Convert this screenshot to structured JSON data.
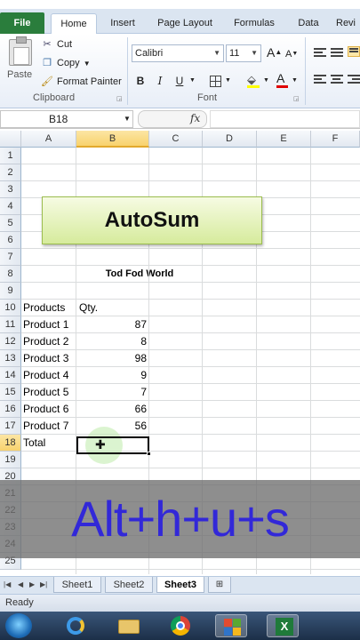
{
  "ribbon": {
    "tabs": {
      "file": "File",
      "home": "Home",
      "insert": "Insert",
      "page_layout": "Page Layout",
      "formulas": "Formulas",
      "data": "Data",
      "review": "Revi"
    },
    "clipboard": {
      "paste": "Paste",
      "cut": "Cut",
      "copy": "Copy",
      "format_painter": "Format Painter",
      "group_label": "Clipboard"
    },
    "font": {
      "font_name": "Calibri",
      "font_size": "11",
      "grow_label": "A",
      "shrink_label": "A",
      "bold": "B",
      "italic": "I",
      "underline": "U",
      "group_label": "Font"
    }
  },
  "formula_bar": {
    "name_box": "B18",
    "fx": "fx",
    "formula": ""
  },
  "grid": {
    "columns": [
      "A",
      "B",
      "C",
      "D",
      "E",
      "F"
    ],
    "rows": [
      "1",
      "2",
      "3",
      "4",
      "5",
      "6",
      "7",
      "8",
      "9",
      "10",
      "11",
      "12",
      "13",
      "14",
      "15",
      "16",
      "17",
      "18",
      "19",
      "20",
      "21",
      "22",
      "23",
      "24",
      "25"
    ],
    "title_cell": "Tod Fod World",
    "header_products": "Products",
    "header_qty": "Qty.",
    "products": [
      {
        "name": "Product 1",
        "qty": "87"
      },
      {
        "name": "Product 2",
        "qty": "8"
      },
      {
        "name": "Product 3",
        "qty": "98"
      },
      {
        "name": "Product 4",
        "qty": "9"
      },
      {
        "name": "Product 5",
        "qty": "7"
      },
      {
        "name": "Product 6",
        "qty": "66"
      },
      {
        "name": "Product 7",
        "qty": "56"
      }
    ],
    "total_label": "Total"
  },
  "overlay": {
    "autosum_label": "AutoSum",
    "shortcut": "Alt+h+u+s"
  },
  "sheets": {
    "tabs": [
      "Sheet1",
      "Sheet2",
      "Sheet3"
    ],
    "active": "Sheet3"
  },
  "status": {
    "text": "Ready"
  },
  "colors": {
    "file_tab": "#2a7d3c",
    "shortcut_text": "#3228d8",
    "autosum_bg": "#d6eb9c"
  }
}
